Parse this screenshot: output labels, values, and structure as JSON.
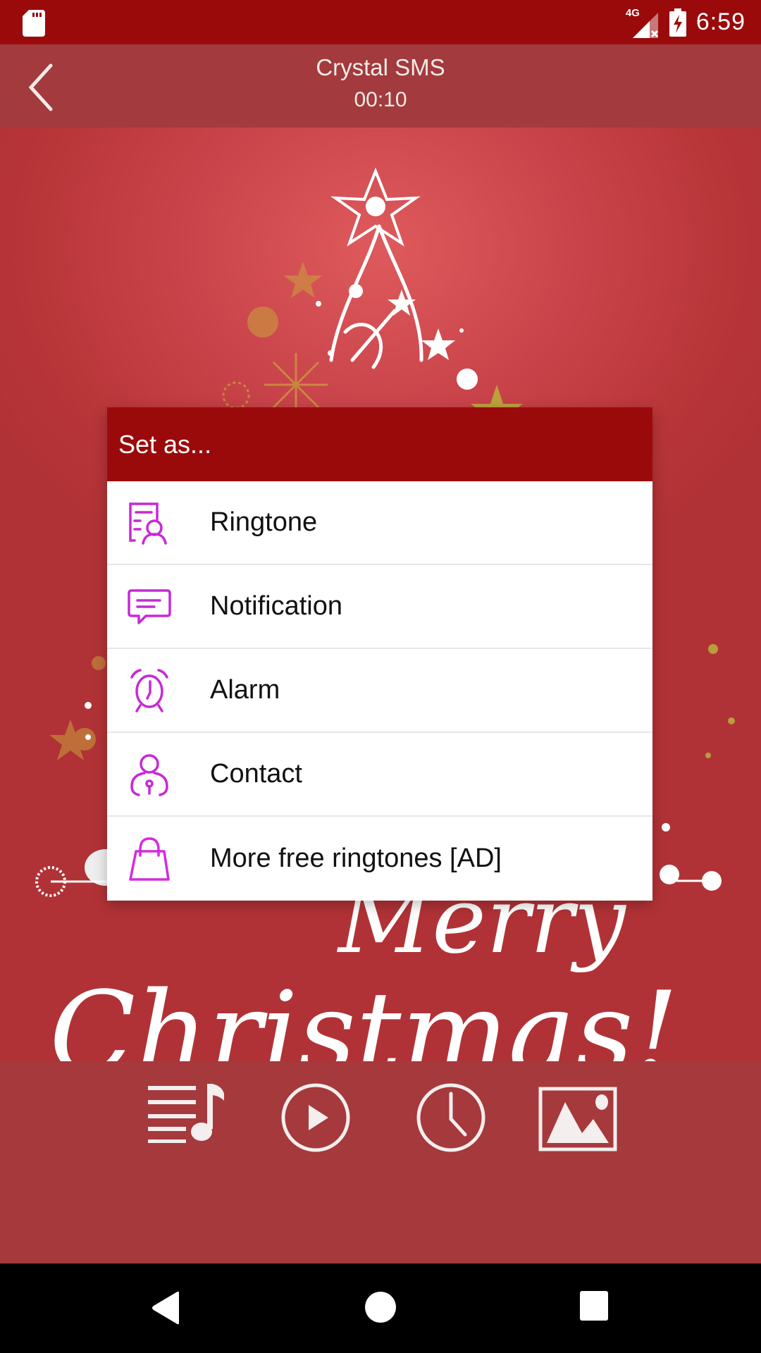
{
  "status_bar": {
    "left_icons": [
      "sd-card-icon"
    ],
    "network_label": "4G",
    "network_icon": "signal-no-data-icon",
    "battery_icon": "battery-charging-icon",
    "time": "6:59"
  },
  "app_bar": {
    "back_icon": "chevron-left-icon",
    "title": "Crystal SMS",
    "duration": "00:10"
  },
  "background": {
    "artwork": "Christmas tree illustration with stars",
    "greeting_text": "Merry Christmas!"
  },
  "dialog": {
    "title": "Set as...",
    "items": [
      {
        "label": "Ringtone",
        "icon": "ringtone-contact-list-icon"
      },
      {
        "label": "Notification",
        "icon": "message-bubble-icon"
      },
      {
        "label": "Alarm",
        "icon": "alarm-clock-icon"
      },
      {
        "label": "Contact",
        "icon": "contact-person-icon"
      },
      {
        "label": "More free ringtones [AD]",
        "icon": "shopping-bag-icon"
      }
    ]
  },
  "controls": [
    {
      "name": "playlist",
      "icon": "playlist-music-icon"
    },
    {
      "name": "play",
      "icon": "play-circle-icon"
    },
    {
      "name": "timer",
      "icon": "clock-icon"
    },
    {
      "name": "image",
      "icon": "image-icon"
    }
  ],
  "nav_bar": {
    "buttons": [
      "back-triangle-icon",
      "home-circle-icon",
      "recents-square-icon"
    ]
  },
  "colors": {
    "status_bar": "#9a0a0b",
    "app_bar": "#a23a3e",
    "dialog_header": "#9b0a0b",
    "icon_accent": "#c729d6",
    "control_bar": "#a5393c"
  }
}
